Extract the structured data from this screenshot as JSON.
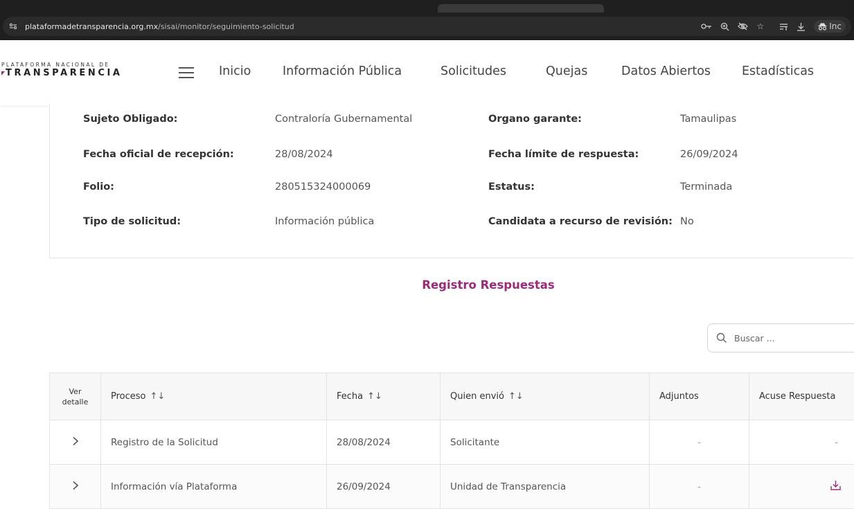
{
  "browser": {
    "url_domain": "plataformadetransparencia.org.mx",
    "url_path": "/sisai/monitor/seguimiento-solicitud",
    "incognito_label": "Inc"
  },
  "logo": {
    "line1": "PLATAFORMA NACIONAL DE",
    "line2": "TRANSPARENCIA"
  },
  "nav": {
    "items": [
      "Inicio",
      "Información Pública",
      "Solicitudes",
      "Quejas",
      "Datos Abiertos",
      "Estadísticas"
    ]
  },
  "details": {
    "sujeto_label": "Sujeto Obligado:",
    "sujeto_value": "Contraloría Gubernamental",
    "organo_label": "Organo garante:",
    "organo_value": "Tamaulipas",
    "fecha_rec_label": "Fecha oficial de recepción:",
    "fecha_rec_value": "28/08/2024",
    "fecha_lim_label": "Fecha límite de respuesta:",
    "fecha_lim_value": "26/09/2024",
    "folio_label": "Folio:",
    "folio_value": "280515324000069",
    "estatus_label": "Estatus:",
    "estatus_value": "Terminada",
    "tipo_label": "Tipo de solicitud:",
    "tipo_value": "Información pública",
    "candidata_label": "Candidata a recurso de revisión:",
    "candidata_value": "No"
  },
  "section_title": "Registro Respuestas",
  "search": {
    "placeholder": "Buscar ..."
  },
  "table": {
    "headers": {
      "ver_detalle_1": "Ver",
      "ver_detalle_2": "detalle",
      "proceso": "Proceso",
      "fecha": "Fecha",
      "quien": "Quien envió",
      "adjuntos": "Adjuntos",
      "acuse": "Acuse Respuesta"
    },
    "rows": [
      {
        "proceso": "Registro de la Solicitud",
        "fecha": "28/08/2024",
        "quien": "Solicitante",
        "adjuntos": "-",
        "acuse": "-"
      },
      {
        "proceso": "Información vía Plataforma",
        "fecha": "26/09/2024",
        "quien": "Unidad de Transparencia",
        "adjuntos": "-",
        "acuse_icon": "download-icon"
      }
    ]
  },
  "colors": {
    "accent": "#9d2a78",
    "chrome": "#1f1f1f"
  }
}
